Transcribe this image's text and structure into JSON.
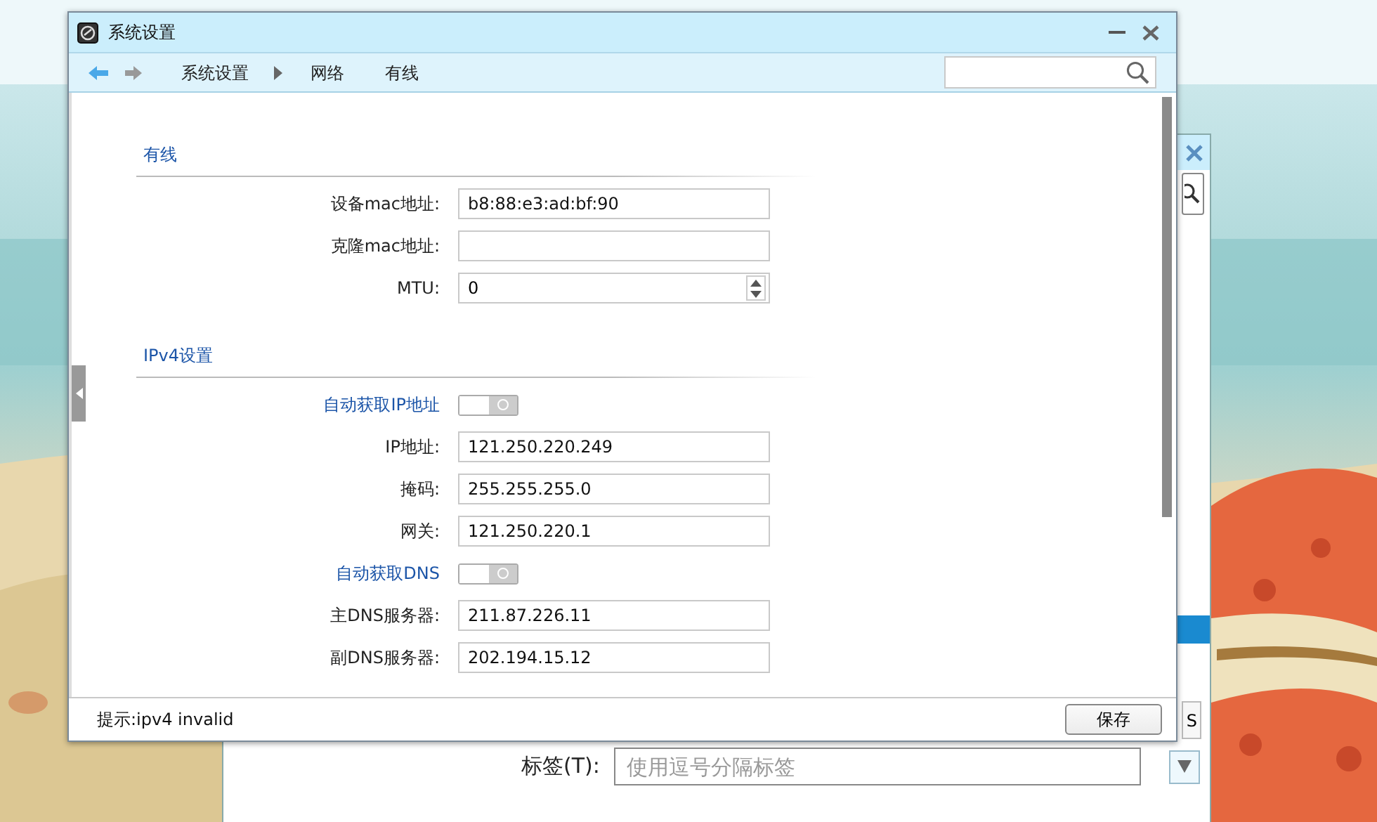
{
  "window": {
    "title": "系统设置"
  },
  "toolbar": {
    "breadcrumbs": [
      {
        "kind": "link",
        "label": "系统设置"
      },
      {
        "kind": "separator"
      },
      {
        "kind": "link",
        "label": "网络"
      },
      {
        "kind": "link",
        "label": "有线"
      }
    ]
  },
  "sections": [
    {
      "title": "有线",
      "rows": [
        {
          "kind": "field",
          "label": "设备mac地址:",
          "value": "b8:88:e3:ad:bf:90"
        },
        {
          "kind": "field",
          "label": "克隆mac地址:"
        },
        {
          "kind": "spin",
          "label": "MTU:",
          "value": "0"
        }
      ]
    },
    {
      "title": "IPv4设置",
      "rows": [
        {
          "kind": "toggle",
          "label": "自动获取IP地址",
          "on": false
        },
        {
          "kind": "field",
          "label": "IP地址:",
          "value": "121.250.220.249"
        },
        {
          "kind": "field",
          "label": "掩码:",
          "value": "255.255.255.0"
        },
        {
          "kind": "field",
          "label": "网关:",
          "value": "121.250.220.1"
        },
        {
          "kind": "toggle",
          "label": "自动获取DNS",
          "on": false
        },
        {
          "kind": "field",
          "label": "主DNS服务器:",
          "value": "211.87.226.11"
        },
        {
          "kind": "field",
          "label": "副DNS服务器:",
          "value": "202.194.15.12"
        }
      ]
    }
  ],
  "status_bar": {
    "hint": "提示:ipv4 invalid",
    "save_button": "保存"
  },
  "background_window": {
    "button_fragment": "S",
    "tag_label": "标签(T):",
    "tag_placeholder": "使用逗号分隔标签"
  }
}
